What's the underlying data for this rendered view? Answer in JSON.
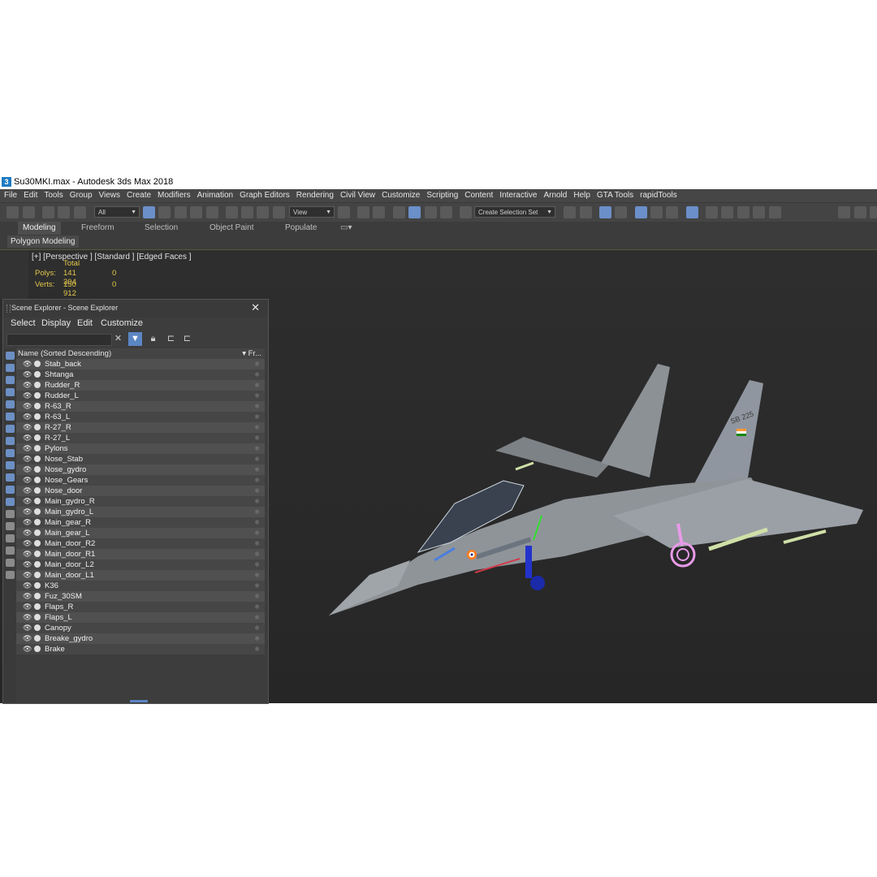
{
  "window": {
    "title": "Su30MKI.max - Autodesk 3ds Max 2018",
    "app_icon_glyph": "3"
  },
  "menu": [
    "File",
    "Edit",
    "Tools",
    "Group",
    "Views",
    "Create",
    "Modifiers",
    "Animation",
    "Graph Editors",
    "Rendering",
    "Civil View",
    "Customize",
    "Scripting",
    "Content",
    "Interactive",
    "Arnold",
    "Help",
    "GTA Tools",
    "rapidTools"
  ],
  "toolbar": {
    "filter_value": "All",
    "coord_value": "View",
    "selection_set_placeholder": "Create Selection Set"
  },
  "ribbon": {
    "tabs": [
      "Modeling",
      "Freeform",
      "Selection",
      "Object Paint",
      "Populate"
    ],
    "active_tab": "Modeling",
    "panel_label": "Polygon Modeling"
  },
  "viewport": {
    "label": "[+] [Perspective ]  [Standard ]  [Edged Faces ]",
    "stats": {
      "header": "Total",
      "polys_label": "Polys:",
      "polys_total": "141 304",
      "polys_sel": "0",
      "verts_label": "Verts:",
      "verts_total": "150 912",
      "verts_sel": "0"
    }
  },
  "scene_explorer": {
    "title": "Scene Explorer - Scene Explorer",
    "menu": [
      "Select",
      "Display",
      "Edit",
      "Customize"
    ],
    "column_name": "Name (Sorted Descending)",
    "column_frozen": "Fr...",
    "items": [
      "Stab_back",
      "Shtanga",
      "Rudder_R",
      "Rudder_L",
      "R-63_R",
      "R-63_L",
      "R-27_R",
      "R-27_L",
      "Pylons",
      "Nose_Stab",
      "Nose_gydro",
      "Nose_Gears",
      "Nose_door",
      "Main_gydro_R",
      "Main_gydro_L",
      "Main_gear_R",
      "Main_gear_L",
      "Main_door_R2",
      "Main_door_R1",
      "Main_door_L2",
      "Main_door_L1",
      "K36",
      "Fuz_30SM",
      "Flaps_R",
      "Flaps_L",
      "Canopy",
      "Breake_gydro",
      "Brake"
    ]
  },
  "aircraft": {
    "tail_code": "SB 225"
  },
  "colors": {
    "accent": "#5b86c4",
    "stats_text": "#e4c84a",
    "jet_body": "#8a8f94",
    "gear_blue": "#2233cc",
    "gear_pink": "#e89ae8"
  }
}
